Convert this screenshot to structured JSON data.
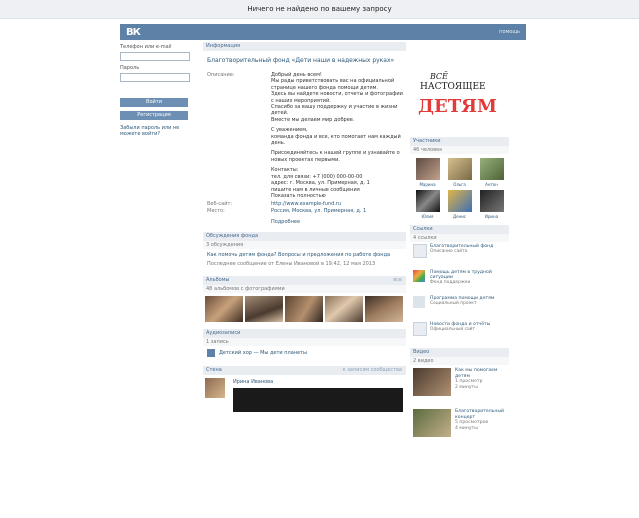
{
  "top_notice": "Ничего не найдено по вашему запросу",
  "header": {
    "logo": "ВК",
    "help_link": "помощь"
  },
  "login": {
    "email_label": "Телефон или e-mail",
    "password_label": "Пароль",
    "login_button": "Войти",
    "register_button": "Регистрация",
    "forgot_link": "Забыли пароль или не можете войти?"
  },
  "main": {
    "tab": "Информация",
    "page_title": "Благотворительный фонд «Дети наши в надежных руках»",
    "info": [
      {
        "label": "Описание:",
        "value": "Добрый день всем!\nМы рады приветствовать вас на официальной странице нашего фонда помощи детям.\nЗдесь вы найдете новости, отчеты и фотографии с наших мероприятий.\nСпасибо за вашу поддержку и участие в жизни детей.\nВместе мы делаем мир добрее."
      },
      {
        "label": "",
        "value": "С уважением,\nкоманда фонда и все, кто помогает нам каждый день."
      },
      {
        "label": "",
        "value": "Присоединяйтесь к нашей группе и узнавайте о новых проектах первыми."
      },
      {
        "label": "",
        "value": "Контакты:\nтел. для связи: +7 (000) 000-00-00\nадрес: г. Москва, ул. Примерная, д. 1\nпишите нам в личные сообщения\nПоказать полностью"
      }
    ],
    "site": {
      "label": "Веб-сайт:",
      "value": "http://www.example-fund.ru"
    },
    "location": {
      "label": "Место:",
      "value": "Россия, Москва, ул. Примерная, д. 1"
    },
    "more_link": "Подробнее",
    "discussion": {
      "title": "Обсуждения фонда",
      "subtitle": "3 обсуждения",
      "topic": "Как помочь детям фонда? Вопросы и предложения по работе фонда",
      "topic_meta": "Последнее сообщение от Елены Ивановой в 19:42, 12 мая 2013"
    },
    "photos": {
      "title": "Альбомы",
      "count_label": "все",
      "subtitle": "48 альбомов с фотографиями"
    },
    "audio": {
      "title": "Аудиозаписи",
      "subtitle": "1 запись",
      "track": "Детский хор — Мы дети планеты"
    },
    "wall": {
      "title": "Стена",
      "right": "к записям сообщества",
      "author": "Ирина Иванова"
    }
  },
  "right": {
    "brand_line1": "ВСЁ",
    "brand_line2": "НАСТОЯЩЕЕ",
    "brand_line3": "ДЕТЯМ",
    "members": {
      "title": "Участники",
      "count": "46 человек",
      "people": [
        "Марина",
        "Ольга",
        "Антон",
        "Юлия",
        "Денис",
        "Ирина"
      ]
    },
    "links": {
      "title": "Ссылки",
      "count": "4 ссылки",
      "items": [
        {
          "title": "Благотворительный фонд",
          "sub": "Описание сайта"
        },
        {
          "title": "Помощь детям в трудной ситуации",
          "sub": "Фонд поддержки"
        },
        {
          "title": "Программа помощи детям",
          "sub": "Социальный проект"
        },
        {
          "title": "Новости фонда и отчёты",
          "sub": "Официальный сайт"
        }
      ]
    },
    "videos": {
      "title": "Видео",
      "count": "2 видео",
      "items": [
        {
          "title": "Как мы помогаем детям",
          "sub": "1 просмотр\n2 минуты"
        },
        {
          "title": "Благотворительный концерт",
          "sub": "5 просмотров\n4 минуты"
        }
      ]
    }
  }
}
